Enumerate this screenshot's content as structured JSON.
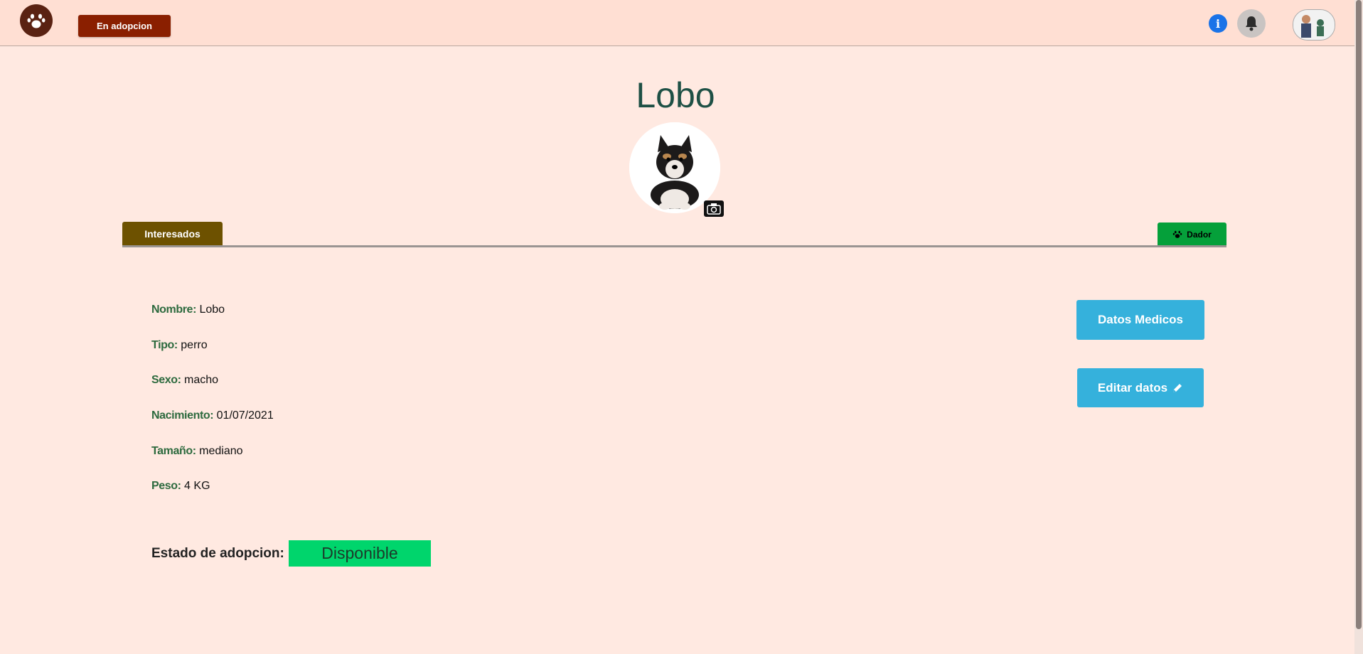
{
  "navbar": {
    "logo_icon": "paw-icon",
    "adoption_button": "En adopcion",
    "info_icon_glyph": "i",
    "notification_icon": "bell-icon",
    "avatar_icon": "user-avatar"
  },
  "pet": {
    "name": "Lobo",
    "photo_icon": "puppy-photo",
    "camera_icon": "camera-icon"
  },
  "tabs": {
    "interesados": "Interesados",
    "dador": "Dador"
  },
  "details": [
    {
      "label": "Nombre",
      "value": "Lobo"
    },
    {
      "label": "Tipo",
      "value": "perro"
    },
    {
      "label": "Sexo",
      "value": "macho"
    },
    {
      "label": "Nacimiento",
      "value": "01/07/2021"
    },
    {
      "label": "Tamaño",
      "value": "mediano"
    },
    {
      "label": "Peso",
      "value": "4 KG"
    }
  ],
  "actions": {
    "medical": "Datos Medicos",
    "edit": "Editar datos"
  },
  "adoption": {
    "label": "Estado de adopcion:",
    "status": "Disponible"
  },
  "colors": {
    "background": "#ffe9e1",
    "navbar": "#ffdfd3",
    "adoption_button": "#8a1f00",
    "tab_interesados": "#6d5100",
    "tab_dador": "#05a03a",
    "action_button": "#35b1dc",
    "status_available": "#00d56c",
    "label_green": "#2d6a3e",
    "title": "#1e5045"
  }
}
